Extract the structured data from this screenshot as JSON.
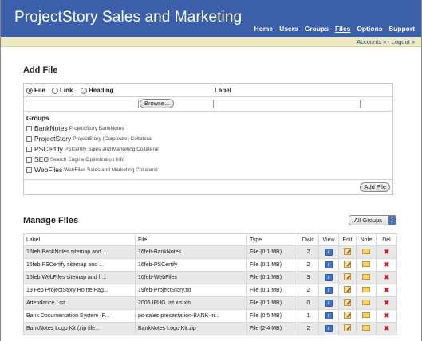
{
  "app": {
    "title": "ProjectStory Sales and Marketing"
  },
  "nav": {
    "items": [
      "Home",
      "Users",
      "Groups",
      "Files",
      "Options",
      "Support"
    ],
    "active": "Files"
  },
  "subnav": {
    "accounts": "Accounts »",
    "logout": "Logout »"
  },
  "add_file": {
    "title": "Add File",
    "types": [
      {
        "label": "File",
        "selected": true
      },
      {
        "label": "Link",
        "selected": false
      },
      {
        "label": "Heading",
        "selected": false
      }
    ],
    "label_header": "Label",
    "browse_label": "Browse...",
    "groups_header": "Groups",
    "groups": [
      {
        "name": "BankNotes",
        "desc": "ProjectStory BankNotes"
      },
      {
        "name": "ProjectStory",
        "desc": "ProjectStory (Corporate) Collateral"
      },
      {
        "name": "PSCertify",
        "desc": "PSCertify Sales and Marketing Collateral"
      },
      {
        "name": "SEO",
        "desc": "Search Engine Optimization Info"
      },
      {
        "name": "WebFiles",
        "desc": "WebFiles Sales and Marketing Collateral"
      }
    ],
    "submit_label": "Add File"
  },
  "manage": {
    "title": "Manage Files",
    "filter_value": "All Groups",
    "columns": [
      "Label",
      "File",
      "Type",
      "Dwld",
      "View",
      "Edit",
      "Note",
      "Del"
    ],
    "rows": [
      {
        "label": "16feb BankNotes sitemap and ...",
        "file": "16feb-BankNotes",
        "type": "File (0.1 MB)",
        "dwld": "2"
      },
      {
        "label": "16feb PSCertify sitemap and ...",
        "file": "16feb-PSCertify",
        "type": "File (0.1 MB)",
        "dwld": "2"
      },
      {
        "label": "16feb WebFiles sitemap and h...",
        "file": "16feb-WebFiles",
        "type": "File (0.1 MB)",
        "dwld": "3"
      },
      {
        "label": "19 Feb ProjectStory Home Pag...",
        "file": "19feb-ProjectStory.txt",
        "type": "File (0.1 MB)",
        "dwld": "2"
      },
      {
        "label": "Attendance List",
        "file": "2005 IPUG list xls.xls",
        "type": "File (0.1 MB)",
        "dwld": "0"
      },
      {
        "label": "Bank Documentation System (P...",
        "file": "ps-sales-presentation-BANK-m...",
        "type": "File (0.5 MB)",
        "dwld": "1"
      },
      {
        "label": "BankNotes Logo Kit (zip file...",
        "file": "BankNotes Logo Kit.zip",
        "type": "File (2.4 MB)",
        "dwld": "2"
      }
    ]
  }
}
